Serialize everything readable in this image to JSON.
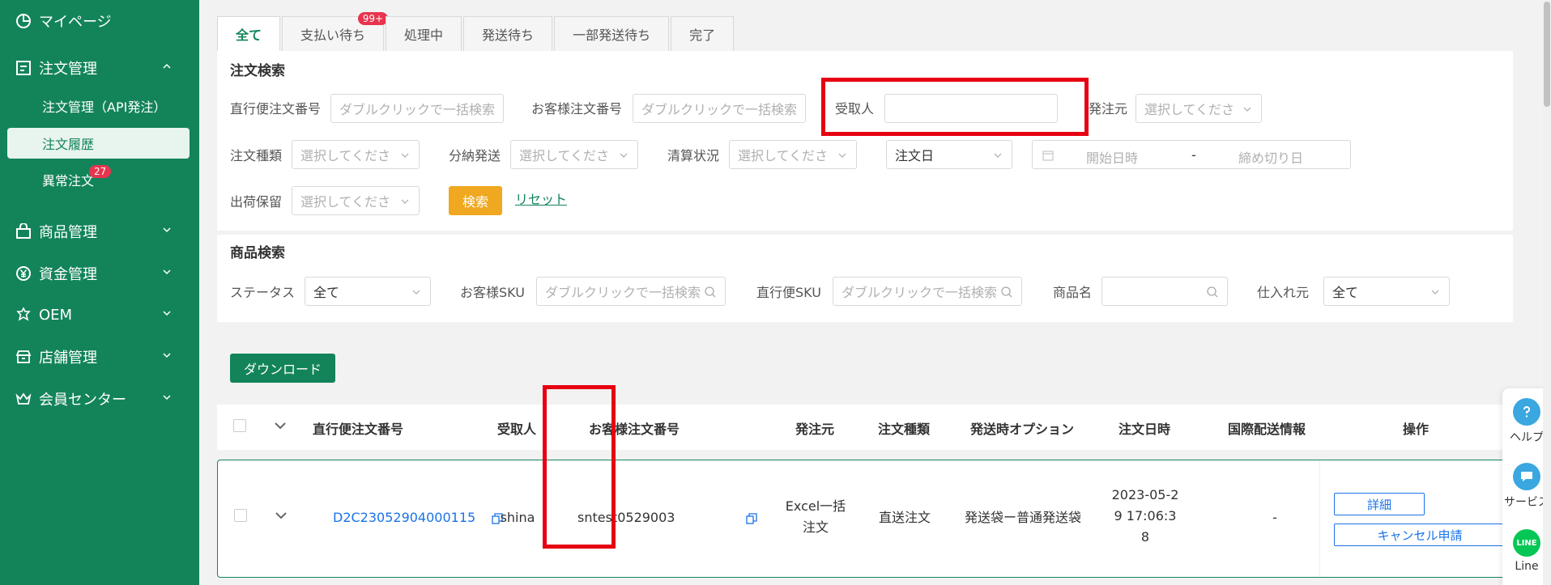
{
  "sidebar": {
    "items": [
      {
        "label": "マイページ",
        "icon": "pie-chart-icon"
      },
      {
        "label": "注文管理",
        "icon": "order-form-icon"
      },
      {
        "label": "商品管理",
        "icon": "shopping-bag-icon"
      },
      {
        "label": "資金管理",
        "icon": "yen-coin-icon"
      },
      {
        "label": "OEM",
        "icon": "oem-tag-icon"
      },
      {
        "label": "店舗管理",
        "icon": "store-icon"
      },
      {
        "label": "会員センター",
        "icon": "crown-icon"
      }
    ],
    "sub_items": [
      {
        "label": "注文管理（API発注）"
      },
      {
        "label": "注文履歴"
      },
      {
        "label": "異常注文",
        "badge": "27"
      }
    ]
  },
  "tabs": [
    {
      "label": "全て"
    },
    {
      "label": "支払い待ち",
      "badge": "99+"
    },
    {
      "label": "処理中"
    },
    {
      "label": "発送待ち"
    },
    {
      "label": "一部発送待ち"
    },
    {
      "label": "完了"
    }
  ],
  "order_search": {
    "title": "注文検索",
    "direct_order_no": {
      "label": "直行便注文番号",
      "placeholder": "ダブルクリックで一括検索"
    },
    "customer_order_no": {
      "label": "お客様注文番号",
      "placeholder": "ダブルクリックで一括検索"
    },
    "recipient": {
      "label": "受取人",
      "value": ""
    },
    "origin": {
      "label": "発注元",
      "placeholder": "選択してくださ"
    },
    "order_type": {
      "label": "注文種類",
      "placeholder": "選択してくださ"
    },
    "split_ship": {
      "label": "分納発送",
      "placeholder": "選択してくださ"
    },
    "settlement": {
      "label": "清算状況",
      "placeholder": "選択してくださ"
    },
    "date_type": {
      "value": "注文日"
    },
    "date_range": {
      "start": "開始日時",
      "sep": "-",
      "end": "締め切り日"
    },
    "ship_hold": {
      "label": "出荷保留",
      "placeholder": "選択してくださ"
    },
    "search_button": "検索",
    "reset_link": "リセット"
  },
  "product_search": {
    "title": "商品検索",
    "status": {
      "label": "ステータス",
      "value": "全て"
    },
    "customer_sku": {
      "label": "お客様SKU",
      "placeholder": "ダブルクリックで一括検索"
    },
    "direct_sku": {
      "label": "直行便SKU",
      "placeholder": "ダブルクリックで一括検索"
    },
    "product_name": {
      "label": "商品名",
      "value": ""
    },
    "supplier": {
      "label": "仕入れ元",
      "value": "全て"
    }
  },
  "download_button": "ダウンロード",
  "table": {
    "headers": [
      "直行便注文番号",
      "受取人",
      "お客様注文番号",
      "発注元",
      "注文種類",
      "発送時オプション",
      "注文日時",
      "国際配送情報",
      "操作"
    ],
    "rows": [
      {
        "direct_order_no": "D2C23052904000115",
        "recipient": "shina",
        "customer_order_no": "sntest0529003",
        "origin_line1": "Excel一括",
        "origin_line2": "注文",
        "order_type": "直送注文",
        "ship_option": "発送袋ー普通発送袋",
        "date_line1": "2023-05-2",
        "date_line2": "9 17:06:3",
        "date_line3": "8",
        "intl_shipping": "-",
        "detail_button": "詳細",
        "cancel_button": "キャンセル申請"
      }
    ]
  },
  "float_bar": [
    {
      "label": "ヘルプ",
      "icon": "help-question-icon"
    },
    {
      "label": "サービス",
      "icon": "chat-service-icon"
    },
    {
      "label": "Line",
      "icon": "line-logo-icon"
    }
  ],
  "colors": {
    "brand_green": "#13845a",
    "highlight_red": "#e60012",
    "search_button": "#f0a820",
    "link_blue": "#1a73e8",
    "badge_red": "#e8344e"
  }
}
